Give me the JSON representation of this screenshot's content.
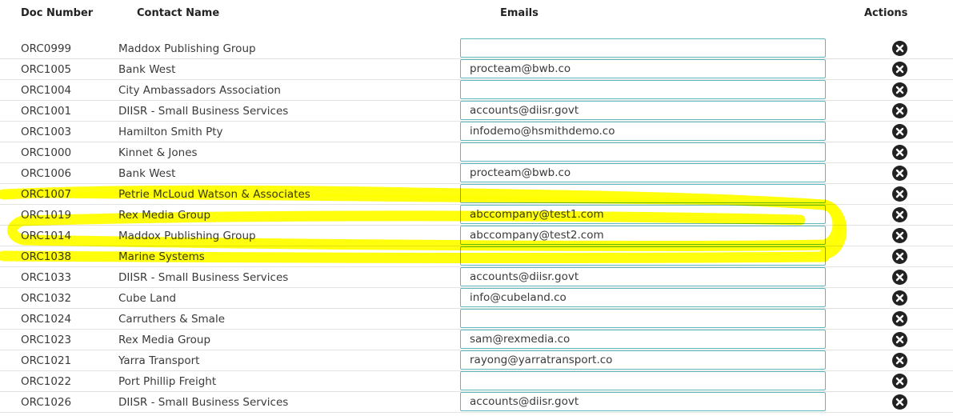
{
  "header": {
    "doc_number": "Doc Number",
    "contact_name": "Contact Name",
    "emails": "Emails",
    "actions": "Actions"
  },
  "rows": [
    {
      "doc": "ORC0999",
      "contact": "Maddox Publishing Group",
      "email": ""
    },
    {
      "doc": "ORC1005",
      "contact": "Bank West",
      "email": "procteam@bwb.co"
    },
    {
      "doc": "ORC1004",
      "contact": "City Ambassadors Association",
      "email": ""
    },
    {
      "doc": "ORC1001",
      "contact": "DIISR - Small Business Services",
      "email": "accounts@diisr.govt"
    },
    {
      "doc": "ORC1003",
      "contact": "Hamilton Smith Pty",
      "email": "infodemo@hsmithdemo.co"
    },
    {
      "doc": "ORC1000",
      "contact": "Kinnet & Jones",
      "email": ""
    },
    {
      "doc": "ORC1006",
      "contact": "Bank West",
      "email": "procteam@bwb.co"
    },
    {
      "doc": "ORC1007",
      "contact": "Petrie McLoud Watson & Associates",
      "email": ""
    },
    {
      "doc": "ORC1019",
      "contact": "Rex Media Group",
      "email": "abccompany@test1.com"
    },
    {
      "doc": "ORC1014",
      "contact": "Maddox Publishing Group",
      "email": "abccompany@test2.com"
    },
    {
      "doc": "ORC1038",
      "contact": "Marine Systems",
      "email": ""
    },
    {
      "doc": "ORC1033",
      "contact": "DIISR - Small Business Services",
      "email": "accounts@diisr.govt"
    },
    {
      "doc": "ORC1032",
      "contact": "Cube Land",
      "email": "info@cubeland.co"
    },
    {
      "doc": "ORC1024",
      "contact": "Carruthers & Smale",
      "email": ""
    },
    {
      "doc": "ORC1023",
      "contact": "Rex Media Group",
      "email": "sam@rexmedia.co"
    },
    {
      "doc": "ORC1021",
      "contact": "Yarra Transport",
      "email": "rayong@yarratransport.co"
    },
    {
      "doc": "ORC1022",
      "contact": "Port Phillip Freight",
      "email": ""
    },
    {
      "doc": "ORC1026",
      "contact": "DIISR - Small Business Services",
      "email": "accounts@diisr.govt"
    }
  ],
  "icons": {
    "remove": "close-circle-icon"
  },
  "colors": {
    "input_border": "#5fb8bf",
    "remove_icon": "#222222",
    "highlight": "#ffff00"
  }
}
